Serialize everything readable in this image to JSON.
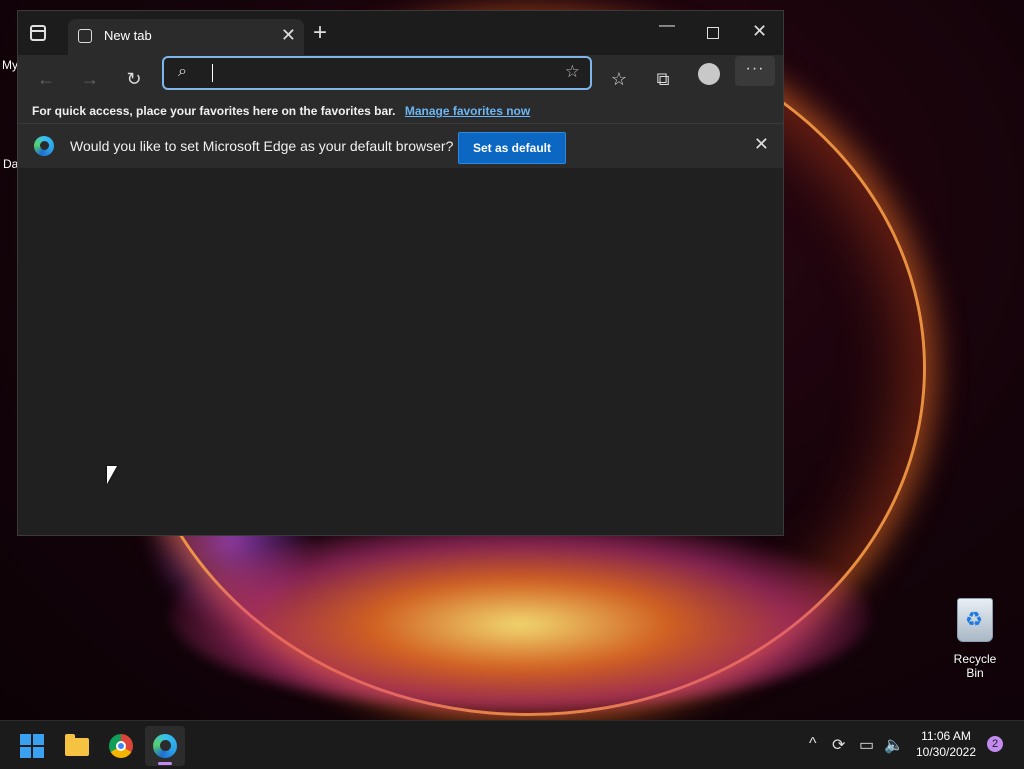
{
  "desktop": {
    "left_label_1": "My",
    "left_label_2": "Da",
    "recycle_bin_label": "Recycle Bin"
  },
  "browser": {
    "tab_title": "New tab",
    "address_value": "",
    "favorites_bar_text": "For quick access, place your favorites here on the favorites bar.",
    "favorites_bar_link": "Manage favorites now",
    "infobar_text": "Would you like to set Microsoft Edge as your default browser?",
    "set_default_label": "Set as default",
    "window_controls": [
      "minimize-icon",
      "maximize-icon",
      "close-icon"
    ]
  },
  "taskbar": {
    "apps": [
      "start-icon",
      "file-explorer-icon",
      "chrome-icon",
      "edge-icon"
    ],
    "time": "11:06 AM",
    "date": "10/30/2022",
    "notification_count": "2"
  },
  "colors": {
    "accent": "#0b67c2",
    "link": "#6cb6f5",
    "address_focus": "#7eb6ea",
    "active_indicator": "#c38bf0"
  }
}
